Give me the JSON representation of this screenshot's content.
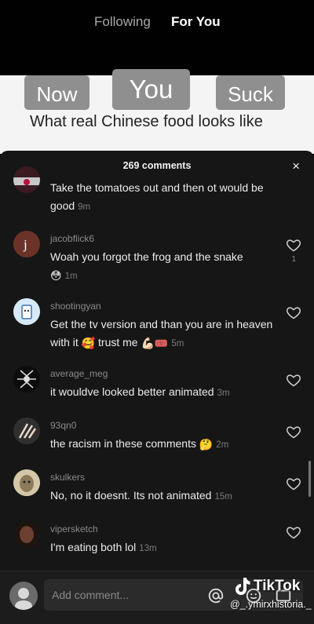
{
  "nav": {
    "following": "Following",
    "for_you": "For You"
  },
  "video": {
    "meme_words": [
      "Now",
      "You",
      "Suck"
    ],
    "caption": "What real Chinese food looks like"
  },
  "comments_header": {
    "count_label": "269 comments",
    "close": "×"
  },
  "comments": [
    {
      "username": "",
      "text": "Take the tomatoes out and then ot would be good",
      "time": "9m",
      "likes": ""
    },
    {
      "username": "jacobflick6",
      "text": "Woah you forgot the frog and the snake",
      "emoji": "😳",
      "time": "1m",
      "likes": "1"
    },
    {
      "username": "shootingyan",
      "text": "Get the tv version and than you are in heaven with it",
      "emoji_mid": "🥰",
      "text2": "trust me",
      "emoji_end": "💪🏻🎟️",
      "time": "5m",
      "likes": ""
    },
    {
      "username": "average_meg",
      "text": "it wouldve looked better animated",
      "time": "3m",
      "likes": ""
    },
    {
      "username": "93qn0",
      "text": "the racism in these comments",
      "emoji": "🤔",
      "time": "2m",
      "likes": ""
    },
    {
      "username": "skulkers",
      "text": "No, no it doesnt. Its not animated",
      "time": "15m",
      "likes": ""
    },
    {
      "username": "vipersketch",
      "text": "I'm eating both lol",
      "time": "13m",
      "likes": ""
    }
  ],
  "composer": {
    "placeholder": "Add comment...",
    "icons": [
      "at-icon",
      "emoji-icon",
      "gif-icon"
    ]
  },
  "watermark": {
    "brand": "TikTok",
    "handle": "@_.ymirxhistoria._"
  },
  "colors": {
    "panel_bg": "#161616",
    "text": "#ececec",
    "muted": "#8a8a8a"
  }
}
